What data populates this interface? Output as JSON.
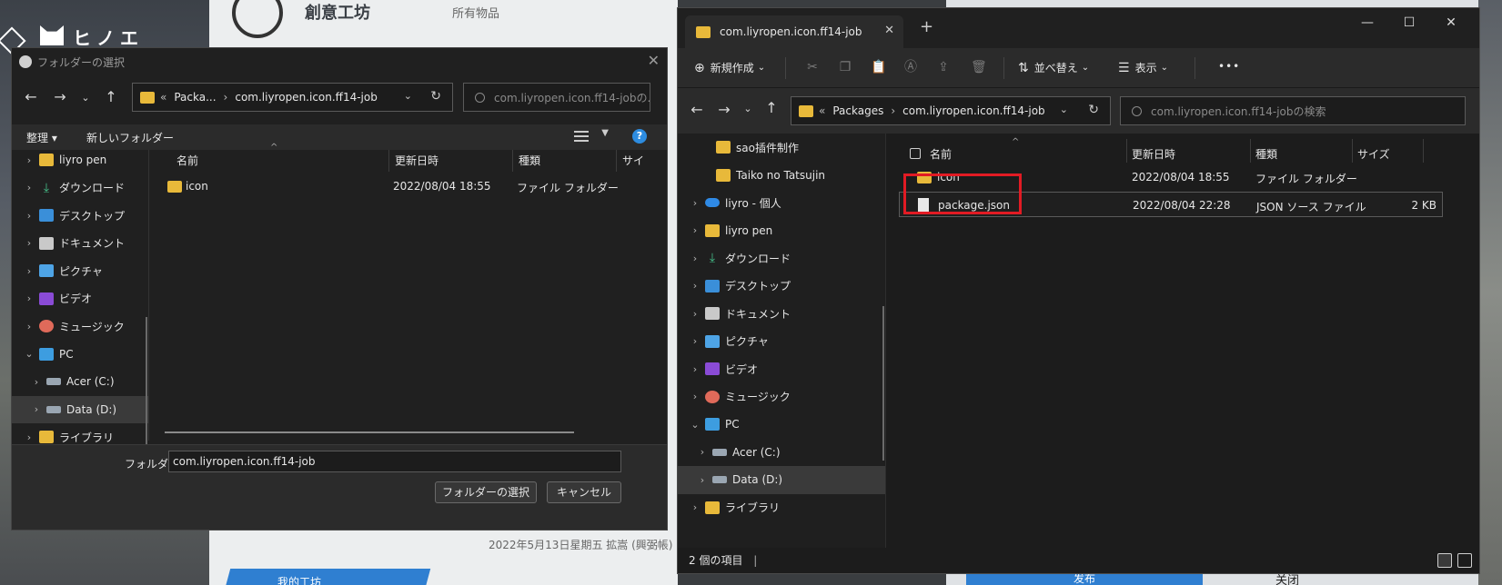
{
  "background": {
    "left_title": "ヒノエ",
    "center_title": "創意工坊",
    "center_sub": "所有物品",
    "caption": "2022年5月13日星期五 拡嵩 (興弼帳)",
    "left_button": "我的工坊",
    "publish_button": "发布",
    "close_button": "关闭"
  },
  "dialog": {
    "title": "フォルダーの選択",
    "close_glyph": "✕",
    "address": {
      "overflow": "«",
      "crumbs": [
        "Packa...",
        "com.liyropen.icon.ff14-job"
      ]
    },
    "search_placeholder": "com.liyropen.icon.ff14-jobの...",
    "toolbar": {
      "organize": "整理",
      "new_folder": "新しいフォルダー",
      "help": "?"
    },
    "columns": {
      "name": "名前",
      "modified": "更新日時",
      "type": "種類",
      "size": "サイ"
    },
    "rows": [
      {
        "name": "icon",
        "modified": "2022/08/04 18:55",
        "type": "ファイル フォルダー"
      }
    ],
    "tree": [
      {
        "label": "liyro pen",
        "icon": "folder"
      },
      {
        "label": "ダウンロード",
        "icon": "download"
      },
      {
        "label": "デスクトップ",
        "icon": "desktop"
      },
      {
        "label": "ドキュメント",
        "icon": "document"
      },
      {
        "label": "ピクチャ",
        "icon": "pictures"
      },
      {
        "label": "ビデオ",
        "icon": "video"
      },
      {
        "label": "ミュージック",
        "icon": "music"
      },
      {
        "label": "PC",
        "icon": "pc"
      },
      {
        "label": "Acer (C:)",
        "icon": "drive"
      },
      {
        "label": "Data (D:)",
        "icon": "drive"
      },
      {
        "label": "ライブラリ",
        "icon": "folder"
      }
    ],
    "footer": {
      "folder_label": "フォルダー:",
      "folder_value": "com.liyropen.icon.ff14-job",
      "select_button": "フォルダーの選択",
      "cancel_button": "キャンセル"
    }
  },
  "explorer": {
    "tab_title": "com.liyropen.icon.ff14-job",
    "tab_close": "✕",
    "new_tab": "+",
    "window_controls": {
      "minimize": "—",
      "maximize": "☐",
      "close": "✕"
    },
    "commands": {
      "new": "新規作成",
      "sort": "並べ替え",
      "view": "表示",
      "more": "•••"
    },
    "address": {
      "overflow": "«",
      "crumbs": [
        "Packages",
        "com.liyropen.icon.ff14-job"
      ]
    },
    "search_placeholder": "com.liyropen.icon.ff14-jobの検索",
    "tree": [
      {
        "label": "sao插件制作",
        "icon": "folder",
        "indent": 1
      },
      {
        "label": "Taiko no Tatsujin",
        "icon": "folder",
        "indent": 1
      },
      {
        "label": "liyro - 個人",
        "icon": "cloud",
        "indent": 0
      },
      {
        "label": "liyro pen",
        "icon": "folder",
        "indent": 0
      },
      {
        "label": "ダウンロード",
        "icon": "download",
        "indent": 0
      },
      {
        "label": "デスクトップ",
        "icon": "desktop",
        "indent": 0
      },
      {
        "label": "ドキュメント",
        "icon": "document",
        "indent": 0
      },
      {
        "label": "ピクチャ",
        "icon": "pictures",
        "indent": 0
      },
      {
        "label": "ビデオ",
        "icon": "video",
        "indent": 0
      },
      {
        "label": "ミュージック",
        "icon": "music",
        "indent": 0
      },
      {
        "label": "PC",
        "icon": "pc",
        "indent": 0
      },
      {
        "label": "Acer (C:)",
        "icon": "drive",
        "indent": 1
      },
      {
        "label": "Data (D:)",
        "icon": "drive",
        "indent": 1
      },
      {
        "label": "ライブラリ",
        "icon": "folder",
        "indent": 0
      }
    ],
    "columns": {
      "name": "名前",
      "modified": "更新日時",
      "type": "種類",
      "size": "サイズ"
    },
    "rows": [
      {
        "name": "icon",
        "modified": "2022/08/04 18:55",
        "type": "ファイル フォルダー",
        "size": "",
        "icon": "folder"
      },
      {
        "name": "package.json",
        "modified": "2022/08/04 22:28",
        "type": "JSON ソース ファイル",
        "size": "2 KB",
        "icon": "file"
      }
    ],
    "status": "2 個の項目"
  },
  "colors": {
    "accent": "#2d8ce0",
    "highlight": "#e21b24",
    "folder": "#e8b93a"
  }
}
